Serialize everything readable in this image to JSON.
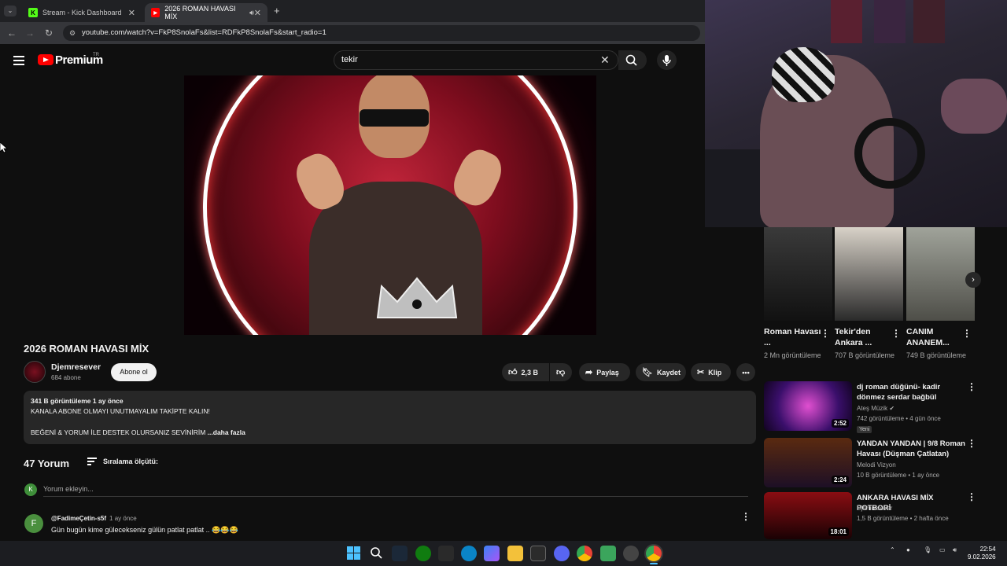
{
  "browser": {
    "tabs": [
      {
        "label": "Stream - Kick Dashboard",
        "active": false
      },
      {
        "label": "2026 ROMAN HAVASI MİX",
        "active": true
      }
    ],
    "url": "youtube.com/watch?v=FkP8SnolaFs&list=RDFkP8SnolaFs&start_radio=1"
  },
  "youtube": {
    "logo_text": "Premium",
    "region": "TR",
    "search_value": "tekir"
  },
  "video": {
    "title": "2026 ROMAN HAVASI MİX",
    "channel": "Djemresever",
    "subscribers": "684 abone",
    "subscribe_label": "Abone ol",
    "likes": "2,3 B",
    "share_label": "Paylaş",
    "save_label": "Kaydet",
    "clip_label": "Klip",
    "description": {
      "meta": "341 B görüntüleme  1 ay önce",
      "line1": "KANALA ABONE OLMAYI UNUTMAYALIM TAKİPTE KALIN!",
      "line2": "BEĞENİ & YORUM İLE DESTEK OLURSANIZ SEVİNİRİM ",
      "more": "...daha fazla"
    }
  },
  "comments": {
    "count": "47 Yorum",
    "sort_label": "Sıralama ölçütü:",
    "my_initial": "K",
    "add_placeholder": "Yorum ekleyin...",
    "items": [
      {
        "initial": "F",
        "author": "@FadimeÇetin-s5f",
        "time": "1 ay önce",
        "text": "Gün bugün kime gülecekseniz gülün patlat patlat .. 😂😂😂"
      }
    ]
  },
  "shorts": [
    {
      "title": "Roman Havası ...",
      "views": "2 Mn görüntüleme"
    },
    {
      "title": "Tekir'den Ankara ...",
      "views": "707 B görüntüleme"
    },
    {
      "title": "CANIM ANANEM...",
      "views": "749 B görüntüleme"
    }
  ],
  "related": [
    {
      "title": "dj roman düğünü- kadir dönmez serdar bağbül",
      "channel": "Ateş Müzik ✔",
      "meta": "742 görüntüleme • 4 gün önce",
      "badge": "Yeni",
      "duration": "2:52"
    },
    {
      "title": "YANDAN YANDAN | 9/8 Roman Havası (Düşman Çatlatan)",
      "channel": "Melodi Vizyon",
      "meta": "10 B görüntüleme • 1 ay önce",
      "badge": "",
      "duration": "2:24"
    },
    {
      "title": "ANKARA HAVASI MİX POTBORİ",
      "channel": "Djemresever",
      "meta": "1,5 B görüntüleme • 2 hafta önce",
      "badge": "",
      "duration": "18:01"
    }
  ],
  "taskbar": {
    "time": "22:54",
    "date": "9.02.2026"
  },
  "colors": {
    "yt_red": "#ff0000",
    "bg": "#0f0f0f",
    "pill": "#272727"
  }
}
